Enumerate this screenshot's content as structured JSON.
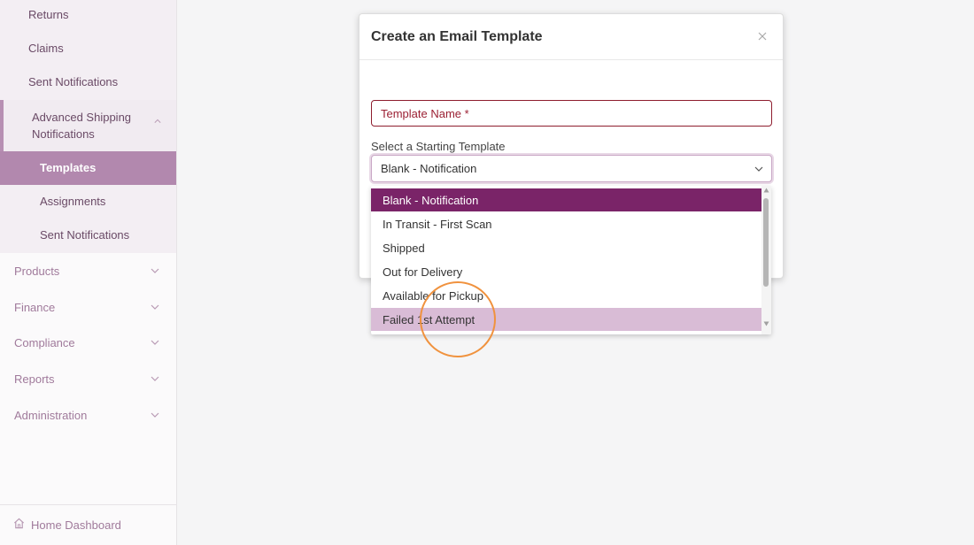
{
  "sidebar": {
    "returns": "Returns",
    "claims": "Claims",
    "sent_notifications": "Sent Notifications",
    "asn": "Advanced Shipping Notifications",
    "asn_sub": {
      "templates": "Templates",
      "assignments": "Assignments",
      "sent_notifications": "Sent Notifications"
    },
    "products": "Products",
    "finance": "Finance",
    "compliance": "Compliance",
    "reports": "Reports",
    "administration": "Administration",
    "home_dashboard": "Home Dashboard"
  },
  "modal": {
    "title": "Create an Email Template",
    "template_name_placeholder": "Template Name *",
    "starting_template_label": "Select a Starting Template",
    "starting_template_value": "Blank - Notification"
  },
  "dropdown": {
    "options": [
      "Blank - Notification",
      "In Transit - First Scan",
      "Shipped",
      "Out for Delivery",
      "Available for Pickup",
      "Failed 1st Attempt"
    ],
    "selected": "Blank - Notification",
    "hovered": "Failed 1st Attempt"
  },
  "colors": {
    "accent": "#7a2468",
    "sidebar_active": "#b288ae",
    "option_hover": "#d9bcd6",
    "error": "#9b2033",
    "cursor_ring": "#f0923e"
  },
  "icons": {
    "close": "close-icon",
    "chevron": "chevron-down-icon",
    "home": "home-icon"
  }
}
